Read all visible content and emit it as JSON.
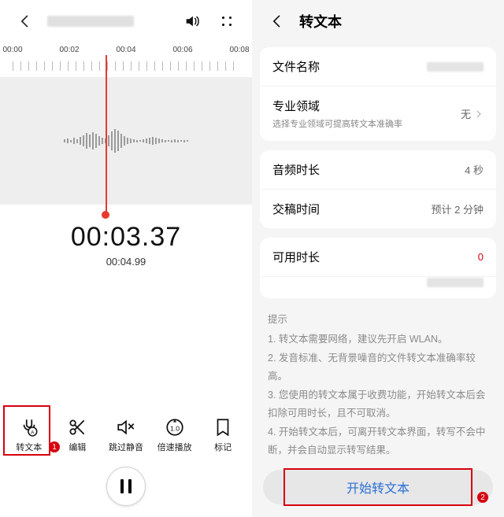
{
  "left": {
    "timeline": {
      "ticks": [
        "00:00",
        "00:02",
        "00:04",
        "00:06",
        "00:08"
      ]
    },
    "current_time": "00:03.37",
    "total_time": "00:04.99",
    "cursor_percent": 42,
    "toolbar": [
      {
        "key": "transcribe",
        "label": "转文本"
      },
      {
        "key": "edit",
        "label": "编辑"
      },
      {
        "key": "skip",
        "label": "跳过静音"
      },
      {
        "key": "speed",
        "label": "倍速播放"
      },
      {
        "key": "mark",
        "label": "标记"
      }
    ],
    "highlight_badge": "1"
  },
  "right": {
    "title": "转文本",
    "rows": {
      "filename_label": "文件名称",
      "domain_label": "专业领域",
      "domain_sub": "选择专业领域可提高转文本准确率",
      "domain_value": "无",
      "duration_label": "音频时长",
      "duration_value": "4 秒",
      "eta_label": "交稿时间",
      "eta_value": "预计 2 分钟",
      "quota_label": "可用时长",
      "quota_value": "0"
    },
    "hints_title": "提示",
    "hints": [
      "1. 转文本需要网络，建议先开启 WLAN。",
      "2. 发音标准、无背景噪音的文件转文本准确率较高。",
      "3. 您使用的转文本属于收费功能，开始转文本后会扣除可用时长，且不可取消。",
      "4. 开始转文本后，可离开转文本界面，转写不会中断，并会自动显示转写结果。"
    ],
    "cta_label": "开始转文本",
    "highlight_badge": "2"
  }
}
